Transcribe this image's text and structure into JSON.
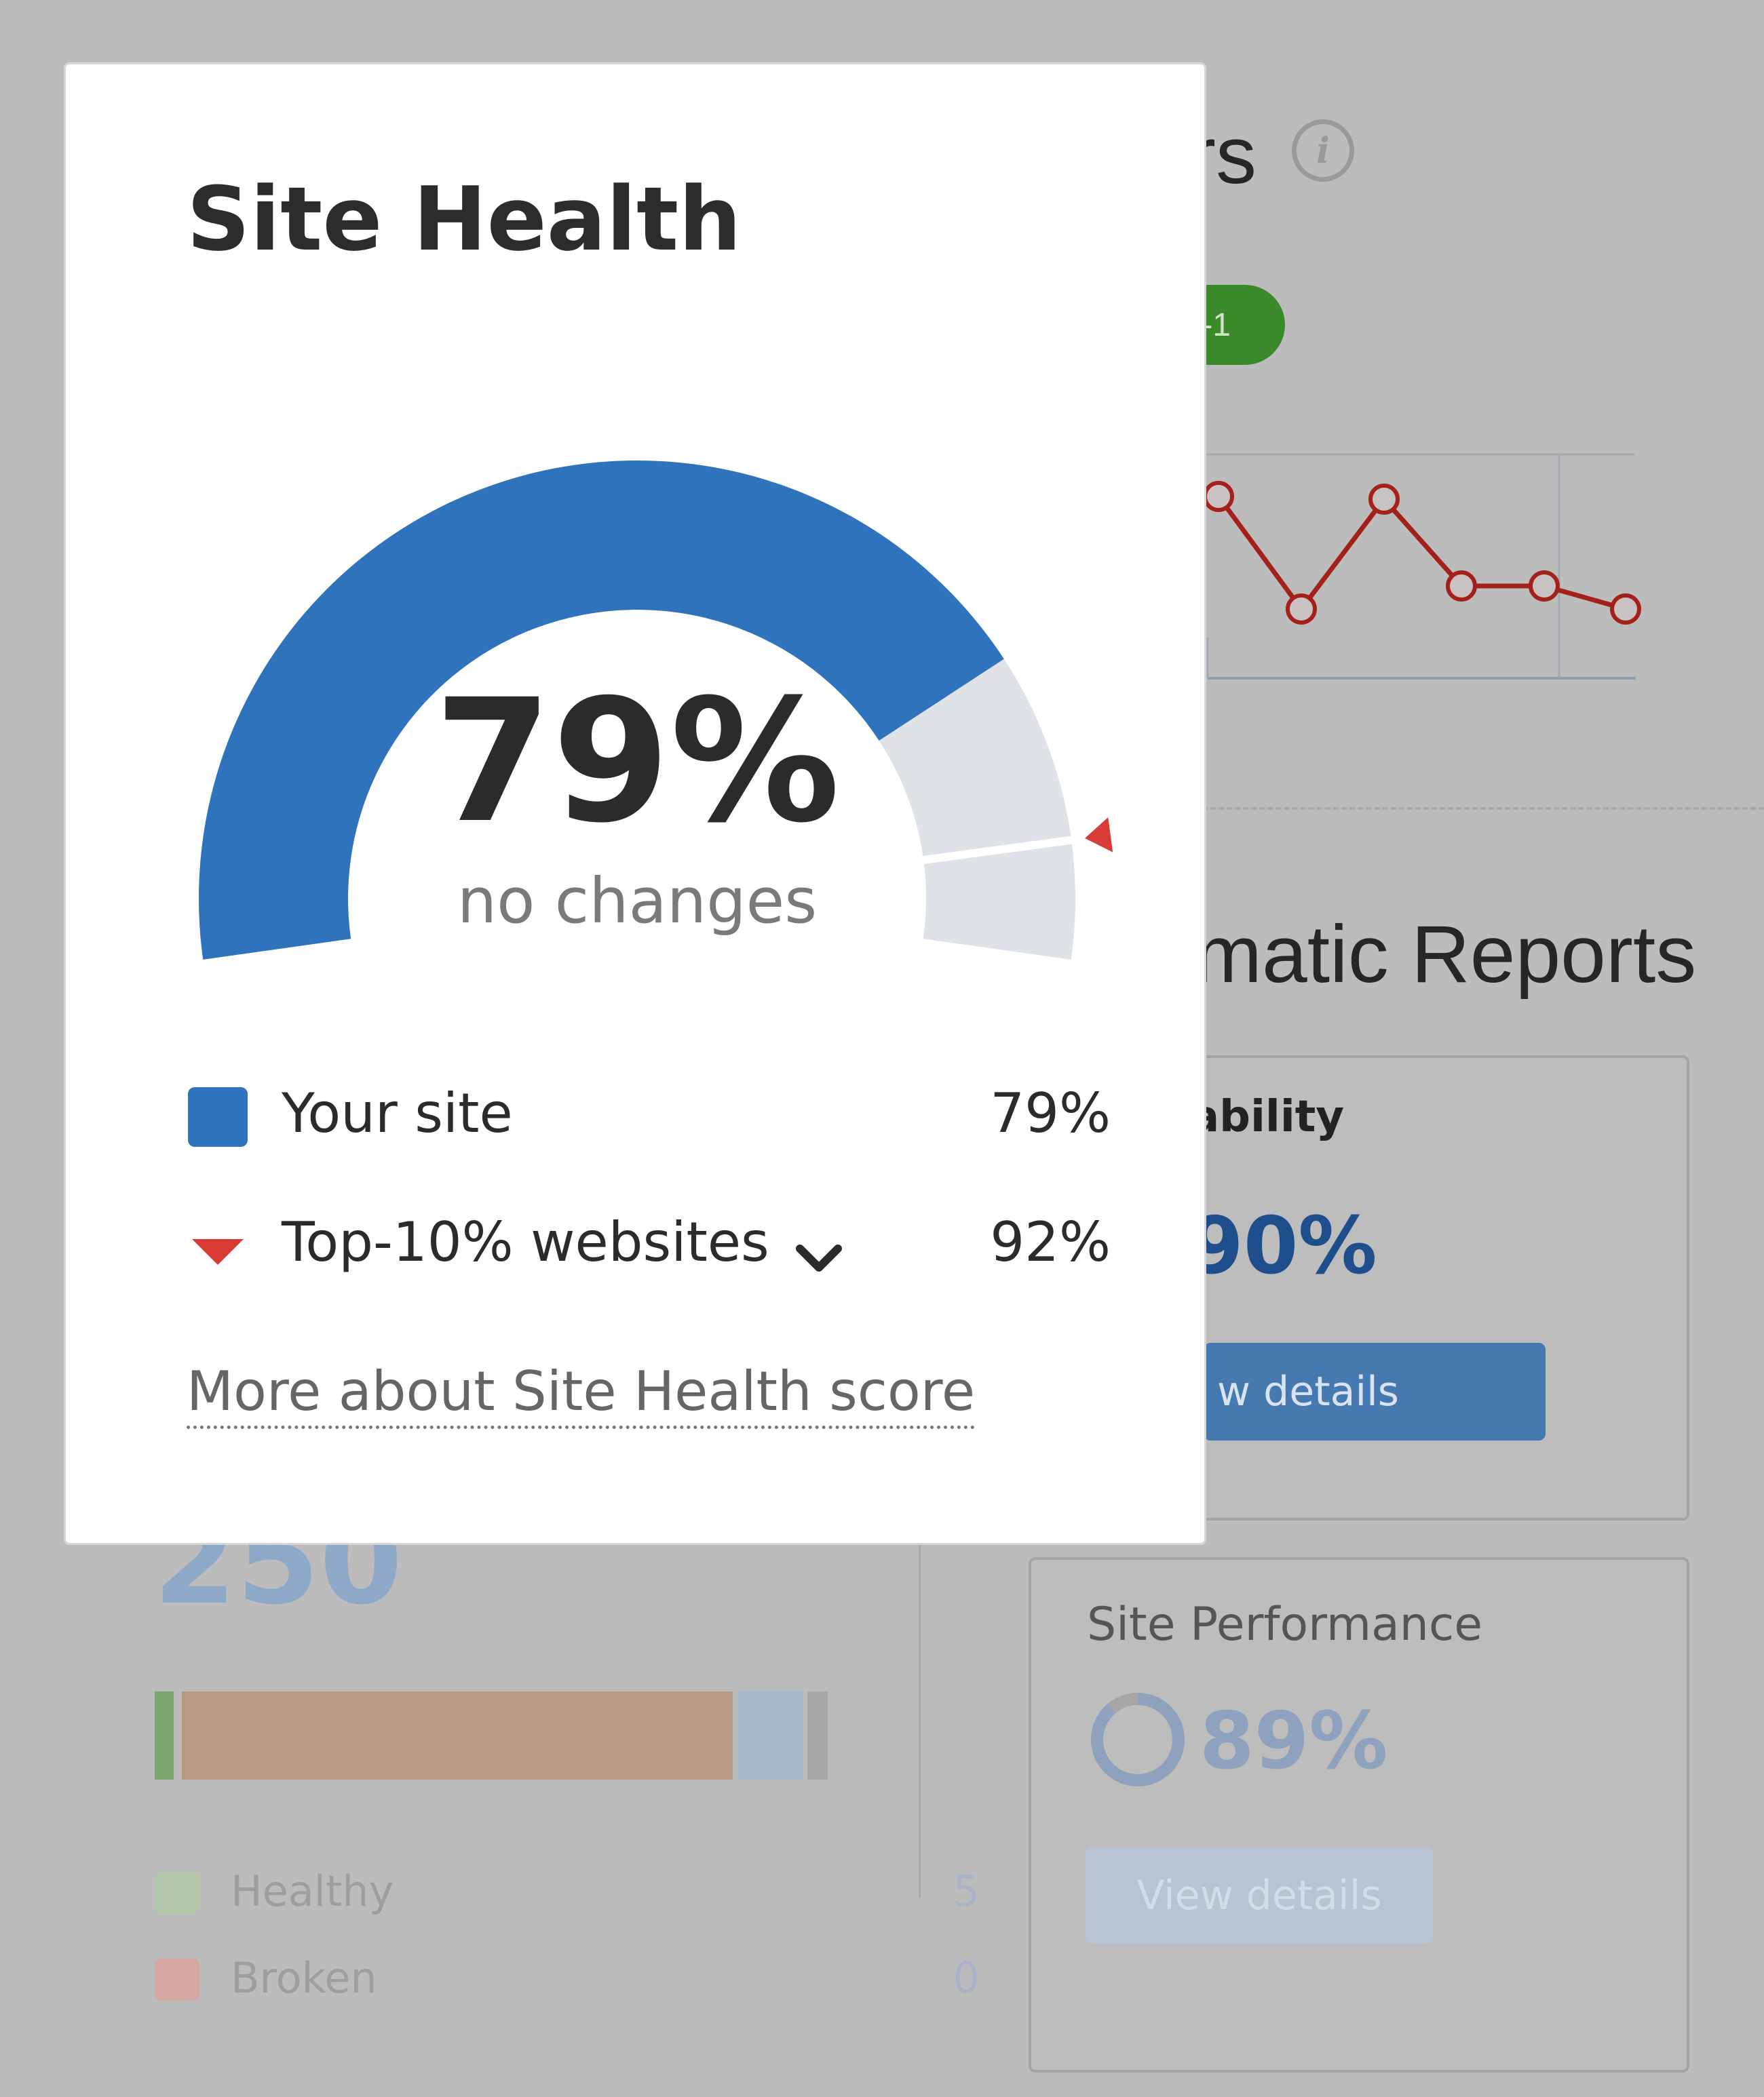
{
  "background": {
    "errors_heading_fragment": "rs",
    "info_icon_glyph": "i",
    "badge_text": "-1",
    "reports_heading_fragment": "matic Reports",
    "crawlability_card": {
      "title_fragment": "lability",
      "value": "90%",
      "button_fragment": "w details"
    },
    "performance_card": {
      "title": "Site Performance",
      "value": "89%",
      "button": "View details"
    },
    "crawled_pages_fragment": "250",
    "legend": [
      {
        "label": "Healthy",
        "value": "5",
        "color": "#b2c6a9"
      },
      {
        "label": "Broken",
        "value": "0",
        "color": "#d6a8a4"
      }
    ],
    "trend_chart": {
      "type": "line",
      "color": "#a3211a"
    },
    "colors": {
      "overlay": "#bcbcbc",
      "bar_healthy": "#7da66f",
      "bar_issues": "#b89a82",
      "bar_redirects": "#a6b7c9",
      "bar_other": "#a9a9a9"
    }
  },
  "modal": {
    "title": "Site Health",
    "gauge": {
      "value_text": "79%",
      "change_text": "no changes",
      "value_fraction": 0.79,
      "benchmark_fraction": 0.92,
      "fill_color": "#3073bd",
      "track_color": "#dfe2e6",
      "marker_color": "#d93b35"
    },
    "legend": {
      "your_site_label": "Your site",
      "your_site_value": "79%",
      "top_label": "Top-10% websites",
      "top_value": "92%"
    },
    "link_text": "More about Site Health score"
  }
}
